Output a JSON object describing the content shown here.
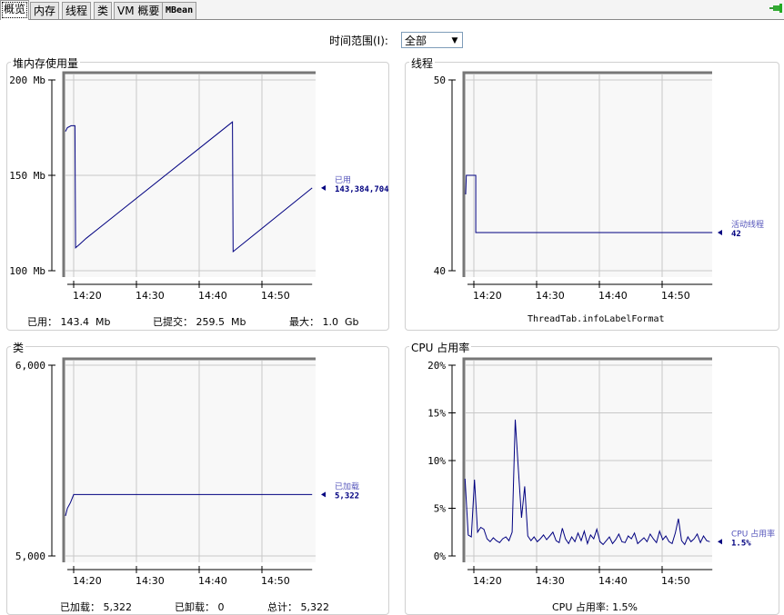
{
  "tabs": [
    {
      "label": "概览",
      "selected": true
    },
    {
      "label": "内存"
    },
    {
      "label": "线程"
    },
    {
      "label": "类"
    },
    {
      "label": "VM 概要"
    },
    {
      "label": "MBean"
    }
  ],
  "connection_icon": "connected-plug-icon",
  "time_range": {
    "label": "时间范围(I):",
    "value": "全部"
  },
  "panels": {
    "heap": {
      "title": "堆内存使用量",
      "info": [
        "已用： 143.4  Mb",
        "已提交： 259.5  Mb",
        "最大： 1.0  Gb"
      ]
    },
    "threads": {
      "title": "线程",
      "info": [
        "ThreadTab.infoLabelFormat"
      ]
    },
    "classes": {
      "title": "类",
      "info": [
        "已加载： 5,322",
        "已卸载： 0",
        "总计： 5,322"
      ]
    },
    "cpu": {
      "title": "CPU 占用率",
      "info": [
        "CPU 占用率: 1.5%"
      ]
    }
  },
  "colors": {
    "series": "#000080",
    "legend_name": "#5555bb",
    "grid": "#c8c8c8",
    "plot_bg": "#f8f8f8"
  },
  "chart_data": [
    {
      "id": "heap",
      "type": "line",
      "title": "堆内存使用量",
      "xlim": [
        18.5,
        58
      ],
      "xticks": [
        {
          "v": 20,
          "label": "14:20"
        },
        {
          "v": 30,
          "label": "14:30"
        },
        {
          "v": 40,
          "label": "14:40"
        },
        {
          "v": 50,
          "label": "14:50"
        }
      ],
      "ylim": [
        100,
        200
      ],
      "yticks": [
        {
          "v": 200,
          "label": "200 Mb"
        },
        {
          "v": 150,
          "label": "150 Mb"
        },
        {
          "v": 100,
          "label": "100 Mb"
        }
      ],
      "series": [
        {
          "name": "已用",
          "value_label": "143,384,704",
          "points": [
            [
              18.7,
              173
            ],
            [
              19,
              175
            ],
            [
              19.6,
              176
            ],
            [
              20.2,
              176
            ],
            [
              20.3,
              112
            ],
            [
              21,
              114
            ],
            [
              22,
              117
            ],
            [
              45.3,
              178
            ],
            [
              45.4,
              110
            ],
            [
              58,
              143.4
            ]
          ]
        }
      ]
    },
    {
      "id": "threads",
      "type": "line",
      "title": "线程",
      "xlim": [
        18.5,
        58
      ],
      "xticks": [
        {
          "v": 20,
          "label": "14:20"
        },
        {
          "v": 30,
          "label": "14:30"
        },
        {
          "v": 40,
          "label": "14:40"
        },
        {
          "v": 50,
          "label": "14:50"
        }
      ],
      "ylim": [
        40,
        50
      ],
      "yticks": [
        {
          "v": 50,
          "label": "50"
        },
        {
          "v": 40,
          "label": "40"
        }
      ],
      "series": [
        {
          "name": "活动线程",
          "value_label": "42",
          "points": [
            [
              18.7,
              44
            ],
            [
              18.8,
              45
            ],
            [
              20.3,
              45
            ],
            [
              20.3,
              42
            ],
            [
              58,
              42
            ]
          ]
        }
      ]
    },
    {
      "id": "classes",
      "type": "line",
      "title": "类",
      "xlim": [
        18.5,
        58
      ],
      "xticks": [
        {
          "v": 20,
          "label": "14:20"
        },
        {
          "v": 30,
          "label": "14:30"
        },
        {
          "v": 40,
          "label": "14:40"
        },
        {
          "v": 50,
          "label": "14:50"
        }
      ],
      "ylim": [
        5000,
        6000
      ],
      "yticks": [
        {
          "v": 6000,
          "label": "6,000"
        },
        {
          "v": 5000,
          "label": "5,000"
        }
      ],
      "series": [
        {
          "name": "已加载",
          "value_label": "5,322",
          "points": [
            [
              18.7,
              5210
            ],
            [
              19,
              5250
            ],
            [
              19.5,
              5280
            ],
            [
              20,
              5322
            ],
            [
              58,
              5322
            ]
          ]
        }
      ]
    },
    {
      "id": "cpu",
      "type": "line",
      "title": "CPU 占用率",
      "xlim": [
        18.5,
        58
      ],
      "xticks": [
        {
          "v": 20,
          "label": "14:20"
        },
        {
          "v": 30,
          "label": "14:30"
        },
        {
          "v": 40,
          "label": "14:40"
        },
        {
          "v": 50,
          "label": "14:50"
        }
      ],
      "ylim": [
        0,
        20
      ],
      "yticks": [
        {
          "v": 20,
          "label": "20%"
        },
        {
          "v": 15,
          "label": "15%"
        },
        {
          "v": 10,
          "label": "10%"
        },
        {
          "v": 5,
          "label": "5%"
        },
        {
          "v": 0,
          "label": "0%"
        }
      ],
      "series": [
        {
          "name": "CPU 占用率",
          "value_label": "1.5%",
          "x_start": 18.6,
          "x_step": 0.5,
          "values": [
            8.1,
            2.2,
            2.0,
            8.0,
            2.5,
            3.0,
            2.8,
            1.8,
            1.5,
            1.9,
            1.6,
            1.4,
            1.8,
            2.0,
            1.6,
            2.5,
            14.3,
            9.0,
            4.0,
            7.3,
            2.1,
            1.6,
            2.0,
            1.5,
            1.8,
            2.2,
            1.7,
            2.1,
            2.5,
            1.6,
            1.4,
            2.9,
            1.8,
            1.3,
            2.0,
            1.5,
            2.4,
            1.6,
            2.6,
            1.3,
            2.2,
            1.8,
            2.8,
            1.5,
            1.2,
            1.6,
            2.0,
            1.3,
            1.7,
            2.3,
            1.5,
            1.4,
            2.1,
            1.8,
            2.4,
            1.3,
            1.6,
            1.9,
            1.5,
            2.3,
            1.8,
            1.4,
            2.6,
            1.7,
            2.1,
            1.5,
            1.3,
            2.4,
            3.9,
            1.6,
            1.2,
            2.0,
            1.5,
            1.8,
            2.3,
            1.4,
            2.1,
            1.6,
            1.5
          ]
        }
      ]
    }
  ]
}
